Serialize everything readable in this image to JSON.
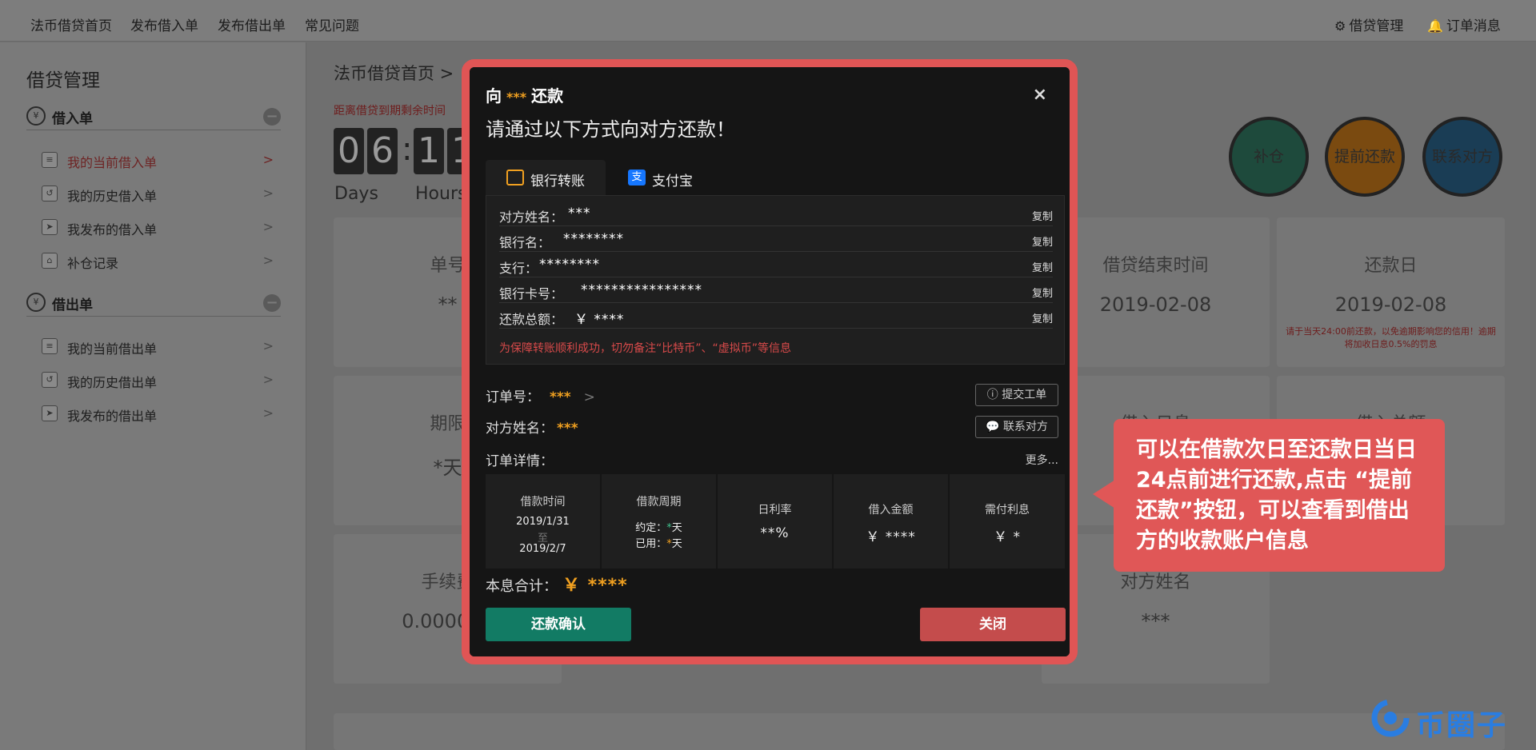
{
  "topnav": {
    "links": [
      "法币借贷首页",
      "发布借入单",
      "发布借出单",
      "常见问题"
    ],
    "right": {
      "manage": "借贷管理",
      "messages": "订单消息"
    }
  },
  "sidebar": {
    "title": "借贷管理",
    "groups": [
      {
        "label": "借入单",
        "items": [
          {
            "label": "我的当前借入单",
            "arrow": ">"
          },
          {
            "label": "我的历史借入单",
            "arrow": ">"
          },
          {
            "label": "我发布的借入单",
            "arrow": ">"
          },
          {
            "label": "补仓记录",
            "arrow": ">"
          }
        ]
      },
      {
        "label": "借出单",
        "items": [
          {
            "label": "我的当前借出单",
            "arrow": ">"
          },
          {
            "label": "我的历史借出单",
            "arrow": ">"
          },
          {
            "label": "我发布的借出单",
            "arrow": ">"
          }
        ]
      }
    ]
  },
  "main": {
    "breadcrumb": "法币借贷首页 >",
    "countdown_label": "距离借贷到期剩余时间",
    "digits": [
      "0",
      "6",
      "1",
      "1"
    ],
    "units": {
      "days": "Days",
      "hours": "Hours"
    },
    "cards": [
      {
        "label": "单号",
        "value": "**"
      },
      {
        "label": "借贷结束时间",
        "value": "2019-02-08"
      },
      {
        "label": "还款日",
        "value": "2019-02-08",
        "note": "请于当天24:00前还款，以免逾期影响您的信用！逾期将加收日息0.5%的罚息"
      },
      {
        "label": "期限",
        "value": "*天"
      },
      {
        "label": "借入日息",
        "value": ""
      },
      {
        "label": "借入总额",
        "value": ""
      },
      {
        "label": "手续费",
        "value": "0.000000"
      },
      {
        "label": "对方姓名",
        "value": "***"
      }
    ],
    "actions": [
      "补仓",
      "提前还款",
      "联系对方"
    ]
  },
  "modal": {
    "title_prefix": "向",
    "title_stars": "***",
    "title_suffix": "还款",
    "close": "×",
    "subtitle": "请通过以下方式向对方还款！",
    "tabs": [
      {
        "label": "银行转账",
        "icon": "bank-card-icon"
      },
      {
        "label": "支付宝",
        "icon": "alipay-icon"
      }
    ],
    "info_rows": [
      {
        "label": "对方姓名：",
        "value": "***",
        "copy": "复制"
      },
      {
        "label": "银行名：",
        "value": "********",
        "copy": "复制"
      },
      {
        "label": "支行：",
        "value": "********",
        "copy": "复制"
      },
      {
        "label": "银行卡号：",
        "value": "****************",
        "copy": "复制"
      },
      {
        "label": "还款总额：",
        "value": "￥ ****",
        "copy": "复制"
      }
    ],
    "warning": "为保障转账顺利成功，切勿备注“比特币”、“虚拟币”等信息",
    "order_no_label": "订单号：",
    "order_no_value": "***",
    "order_arrow": ">",
    "counterparty_label": "对方姓名：",
    "counterparty_value": "***",
    "submit_ticket": "提交工单",
    "contact": "联系对方",
    "detail_label": "订单详情：",
    "more": "更多...",
    "detail": {
      "time_head": "借款时间",
      "time_start": "2019/1/31",
      "time_to": "至",
      "time_end": "2019/2/7",
      "period_head": "借款周期",
      "agreed_label": "约定：",
      "agreed_value": "*",
      "used_label": "已用：",
      "used_value": "*",
      "day_unit": "天",
      "rate_head": "日利率",
      "rate_value": "**%",
      "amount_head": "借入金额",
      "amount_value": "￥ ****",
      "interest_head": "需付利息",
      "interest_value": "￥ *"
    },
    "total_label": "本息合计：",
    "total_value": "￥ ****",
    "confirm": "还款确认",
    "close_btn": "关闭"
  },
  "callout": {
    "text": "可以在借款次日至还款日当日24点前进行还款,点击 “提前还款”按钮，可以查看到借出方的收款账户信息"
  },
  "watermark": {
    "text": "币圈子"
  },
  "colors": {
    "modal_border": "#e05555",
    "accent_orange": "#f0a020",
    "confirm_green": "#127b64",
    "close_red": "#c44c4c",
    "warning_red": "#d84a4a",
    "watermark_blue": "#2a7de1"
  }
}
